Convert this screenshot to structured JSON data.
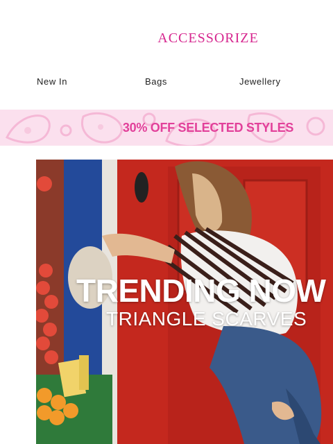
{
  "brand": {
    "logo_text": "ACCESSORIZE",
    "color": "#d6278f"
  },
  "nav": {
    "items": [
      {
        "label": "New In"
      },
      {
        "label": "Bags"
      },
      {
        "label": "Jewellery"
      }
    ]
  },
  "promo": {
    "text": "30% OFF SELECTED STYLES",
    "text_color": "#e2409a",
    "background": "#fbe0ee"
  },
  "hero": {
    "title": "TRENDING NOW",
    "subtitle": "TRIANGLE SCARVES"
  }
}
